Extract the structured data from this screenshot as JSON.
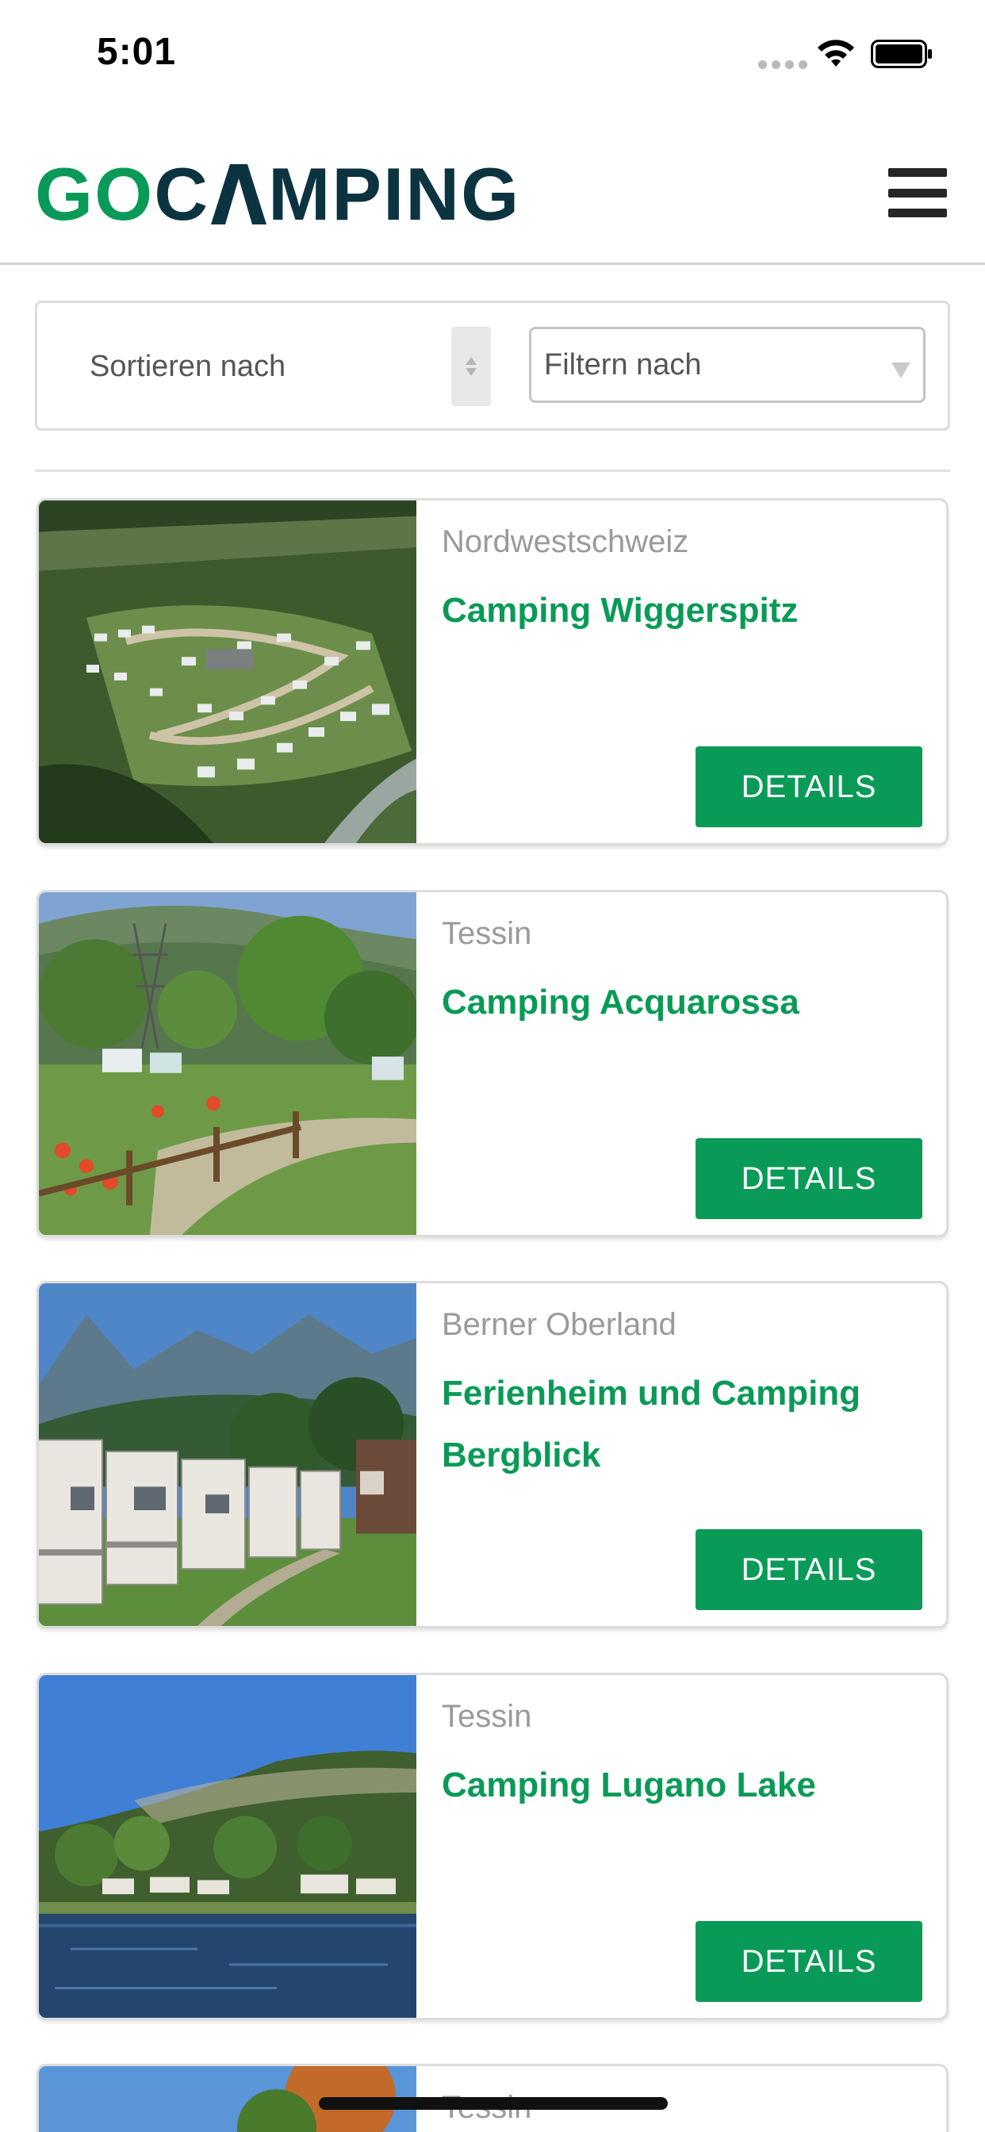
{
  "status_bar": {
    "time": "5:01"
  },
  "header": {
    "logo_go": "GO",
    "logo_c": "C",
    "logo_rest": "MPING",
    "brand_colors": {
      "green": "#0a9a57",
      "dark": "#0c3340"
    },
    "menu_icon": "hamburger-menu-icon"
  },
  "filters": {
    "sort_label": "Sortieren nach",
    "filter_label": "Filtern nach"
  },
  "listings": [
    {
      "region": "Nordwestschweiz",
      "title": "Camping Wiggerspitz",
      "button": "DETAILS"
    },
    {
      "region": "Tessin",
      "title": "Camping Acquarossa",
      "button": "DETAILS"
    },
    {
      "region": "Berner Oberland",
      "title": "Ferienheim und Camping Bergblick",
      "button": "DETAILS"
    },
    {
      "region": "Tessin",
      "title": "Camping Lugano Lake",
      "button": "DETAILS"
    },
    {
      "region": "Tessin"
    }
  ],
  "accent_color": "#0a9a57"
}
